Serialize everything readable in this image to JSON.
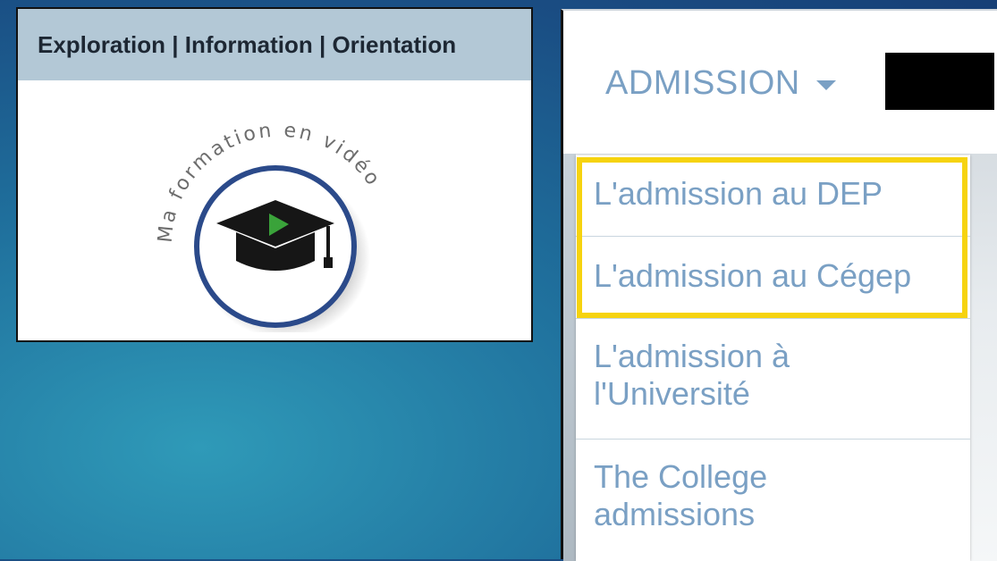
{
  "card": {
    "header": "Exploration | Information | Orientation",
    "logo_text": "Ma formation en vidéo"
  },
  "nav": {
    "admission_label": "ADMISSION"
  },
  "dropdown": {
    "items": [
      {
        "label_lines": [
          "L'admission au DEP"
        ]
      },
      {
        "label_lines": [
          "L'admission au Cégep"
        ]
      },
      {
        "label_lines": [
          "L'admission à",
          "l'Université"
        ]
      },
      {
        "label_lines": [
          "The College",
          "admissions"
        ]
      }
    ]
  },
  "colors": {
    "link": "#7aa0c4",
    "highlight": "#f6d30f",
    "card_header_bg": "#b3c8d6",
    "logo_ring": "#2b4a8a",
    "play_button": "#3aa33a"
  }
}
